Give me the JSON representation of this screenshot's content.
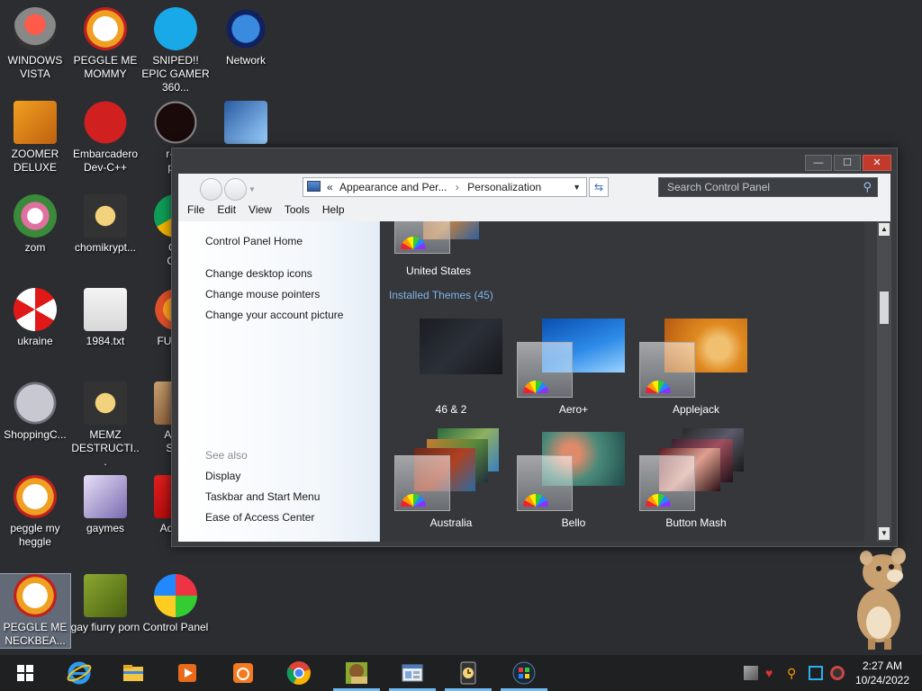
{
  "desktop": {
    "icons": [
      {
        "label": "WINDOWS VISTA",
        "icon": "dome-robot-icon"
      },
      {
        "label": "PEGGLE ME MOMMY",
        "icon": "peggle-icon"
      },
      {
        "label": "SNIPED!! EPIC GAMER 360...",
        "icon": "skype-icon"
      },
      {
        "label": "Network",
        "icon": "network-globe-icon"
      },
      {
        "label": "ZOOMER DELUXE",
        "icon": "zoomer-icon"
      },
      {
        "label": "Embarcadero Dev-C++",
        "icon": "devcpp-icon"
      },
      {
        "label": "r-an\npar",
        "icon": "r-app-icon"
      },
      {
        "label": "",
        "icon": "monitor-app-icon"
      },
      {
        "label": "zom",
        "icon": "flower-icon"
      },
      {
        "label": "chomikrypt...",
        "icon": "clock-file-icon"
      },
      {
        "label": "Go\nChr",
        "icon": "chrome-icon"
      },
      {
        "label": "ukraine",
        "icon": "radiation-icon"
      },
      {
        "label": "1984.txt",
        "icon": "text-file-icon"
      },
      {
        "label": "FURRY",
        "icon": "firefox-icon"
      },
      {
        "label": "ShoppingC...",
        "icon": "flash-icon"
      },
      {
        "label": "MEMZ DESTRUCTI...",
        "icon": "clock-file-icon"
      },
      {
        "label": "Angr\nSea",
        "icon": "angry-birds-icon"
      },
      {
        "label": "peggle my heggle",
        "icon": "peggle-icon"
      },
      {
        "label": "gaymes",
        "icon": "folder-media-icon"
      },
      {
        "label": "Adobe",
        "icon": "adobe-icon"
      },
      {
        "label": "PEGGLE ME NECKBEA...",
        "icon": "peggle-icon"
      },
      {
        "label": "gay fiurry porn",
        "icon": "bonzi-box-icon"
      },
      {
        "label": "Control Panel",
        "icon": "control-panel-icon"
      }
    ]
  },
  "window": {
    "caption": {
      "minimize": "—",
      "maximize": "☐",
      "close": "✕"
    },
    "address": {
      "prefix": "«",
      "crumb1": "Appearance and Per...",
      "crumb2": "Personalization"
    },
    "search_placeholder": "Search Control Panel",
    "menu": [
      "File",
      "Edit",
      "View",
      "Tools",
      "Help"
    ],
    "left_pane": {
      "home": "Control Panel Home",
      "links": [
        "Change desktop icons",
        "Change mouse pointers",
        "Change your account picture"
      ],
      "see_also_label": "See also",
      "see_also": [
        "Display",
        "Taskbar and Start Menu",
        "Ease of Access Center"
      ]
    },
    "themes": {
      "top_theme": "United States",
      "installed_header": "Installed Themes (45)",
      "items": [
        "46 & 2",
        "Aero+",
        "Applejack",
        "Australia",
        "Bello",
        "Button Mash"
      ]
    }
  },
  "taskbar": {
    "apps": [
      "start-icon",
      "internet-explorer-icon",
      "file-explorer-icon",
      "media-player-icon",
      "uc-browser-icon",
      "chrome-icon",
      "bonzi-box-icon",
      "control-panel-window-icon",
      "clock-file-icon",
      "vista-start-orb-icon"
    ],
    "time": "2:27 AM",
    "date": "10/24/2022"
  }
}
